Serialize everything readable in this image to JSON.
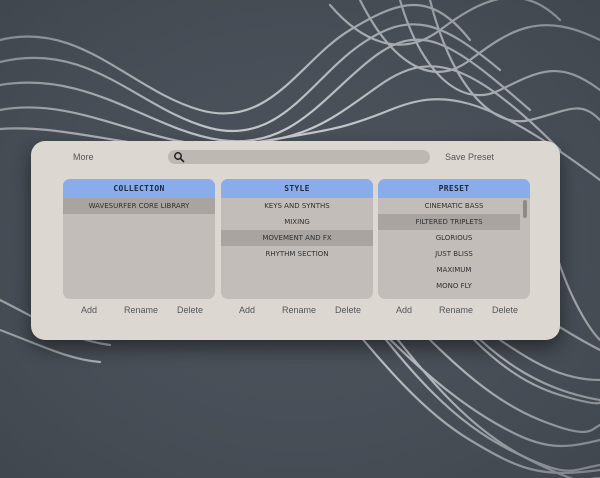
{
  "toolbar": {
    "more_label": "More",
    "search_value": "",
    "save_label": "Save Preset"
  },
  "columns": [
    {
      "header": "COLLECTION",
      "items": [
        "WAVESURFER CORE LIBRARY"
      ],
      "selected_index": 0,
      "actions": {
        "add": "Add",
        "rename": "Rename",
        "delete": "Delete"
      }
    },
    {
      "header": "STYLE",
      "items": [
        "KEYS AND SYNTHS",
        "MIXING",
        "MOVEMENT AND FX",
        "RHYTHM SECTION"
      ],
      "selected_index": 2,
      "actions": {
        "add": "Add",
        "rename": "Rename",
        "delete": "Delete"
      }
    },
    {
      "header": "PRESET",
      "items": [
        "CINEMATIC BASS",
        "FILTERED TRIPLETS",
        "GLORIOUS",
        "JUST BLISS",
        "MAXIMUM",
        "MONO FLY"
      ],
      "selected_index": 1,
      "actions": {
        "add": "Add",
        "rename": "Rename",
        "delete": "Delete"
      }
    }
  ],
  "colors": {
    "background": "#4b525b",
    "panel": "#dcd7d1",
    "header_accent": "#8aacea",
    "list_bg": "#c2bdb8",
    "selected_row": "#a9a4a0"
  }
}
